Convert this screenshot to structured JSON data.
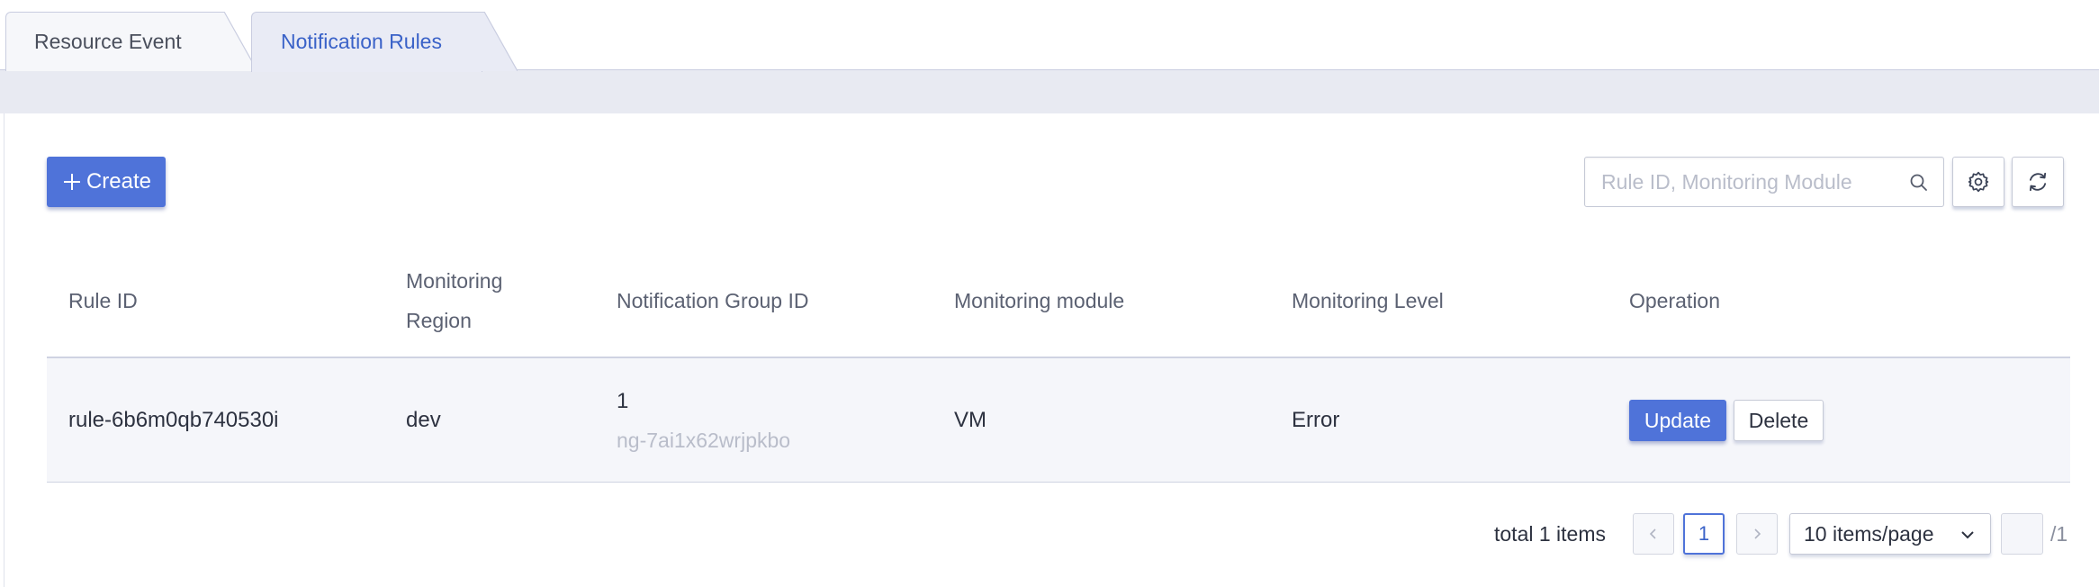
{
  "tabs": [
    {
      "label": "Resource Event",
      "active": false
    },
    {
      "label": "Notification Rules",
      "active": true
    }
  ],
  "toolbar": {
    "create_label": "Create",
    "search_placeholder": "Rule ID, Monitoring Module",
    "search_value": "",
    "icons": {
      "create": "plus-icon",
      "search": "search-icon",
      "settings": "gear-icon",
      "refresh": "refresh-icon"
    }
  },
  "table": {
    "columns": [
      "Rule ID",
      "Monitoring Region",
      "Notification Group ID",
      "Monitoring module",
      "Monitoring Level",
      "Operation"
    ],
    "rows": [
      {
        "rule_id": "rule-6b6m0qb740530i",
        "region": "dev",
        "group_id": "1",
        "group_sub": "ng-7ai1x62wrjpkbo",
        "module": "VM",
        "level": "Error",
        "actions": [
          "Update",
          "Delete"
        ]
      }
    ]
  },
  "pagination": {
    "total_label": "total 1 items",
    "current_page": "1",
    "page_size": "10 items/page",
    "jump_value": "",
    "total_pages_label": "/1"
  },
  "colors": {
    "primary": "#4f73d9",
    "tab_active_text": "#3a62c8",
    "band": "#e8eaf2",
    "row_bg": "#f5f6fa"
  }
}
